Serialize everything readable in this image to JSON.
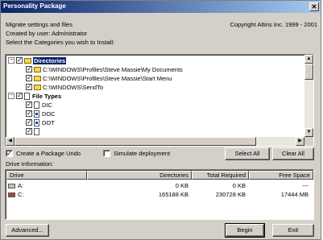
{
  "window": {
    "title": "Personality Package",
    "close_glyph": "✕"
  },
  "header": {
    "line1": "Migrate settings and files",
    "copyright": "Copyright Altiris Inc. 1999 - 2001",
    "line2": "Created by user: Administrator",
    "line3": "Select the Categories you wish to Install:"
  },
  "tree": {
    "items": [
      {
        "label": "Directories",
        "level": 0,
        "expander": "−",
        "icon": "folder",
        "selected": true
      },
      {
        "label": "C:\\WINDOWS\\Profiles\\Steve Massie\\My Documents",
        "level": 1,
        "icon": "folder"
      },
      {
        "label": "C:\\WINDOWS\\Profiles\\Steve Massie\\Start Menu",
        "level": 1,
        "icon": "folder"
      },
      {
        "label": "C:\\WINDOWS\\SendTo",
        "level": 1,
        "icon": "folder"
      },
      {
        "label": "File Types",
        "level": 0,
        "expander": "−",
        "icon": "file",
        "bold": true
      },
      {
        "label": "DIC",
        "level": 1,
        "icon": "file"
      },
      {
        "label": "DOC",
        "level": 1,
        "icon": "word"
      },
      {
        "label": "DOT",
        "level": 1,
        "icon": "word"
      },
      {
        "label": "",
        "level": 1,
        "icon": "file"
      }
    ],
    "check_glyph": "✓"
  },
  "options": {
    "create_undo_label": "Create a Package Undo",
    "create_undo_checked": true,
    "simulate_label": "Simulate deployment",
    "simulate_checked": false,
    "select_all_label": "Select All",
    "clear_all_label": "Clear All"
  },
  "drive_info": {
    "label": "Drive Information:",
    "columns": [
      "Drive",
      "Directories",
      "Total Required",
      "Free Space"
    ],
    "rows": [
      {
        "drive": "A:",
        "directories": "0 KB",
        "total_required": "0 KB",
        "free_space": "---",
        "icon": "floppy-drive"
      },
      {
        "drive": "C:",
        "directories": "165188 KB",
        "total_required": "230728 KB",
        "free_space": "17444 MB",
        "icon": "hard-drive"
      }
    ]
  },
  "footer": {
    "advanced_label": "Advanced...",
    "begin_label": "Begin",
    "exit_label": "Exit"
  },
  "colors": {
    "titlebar_start": "#0a246a",
    "titlebar_end": "#a6caf0",
    "face": "#d4d0c8",
    "selection": "#0a246a"
  }
}
